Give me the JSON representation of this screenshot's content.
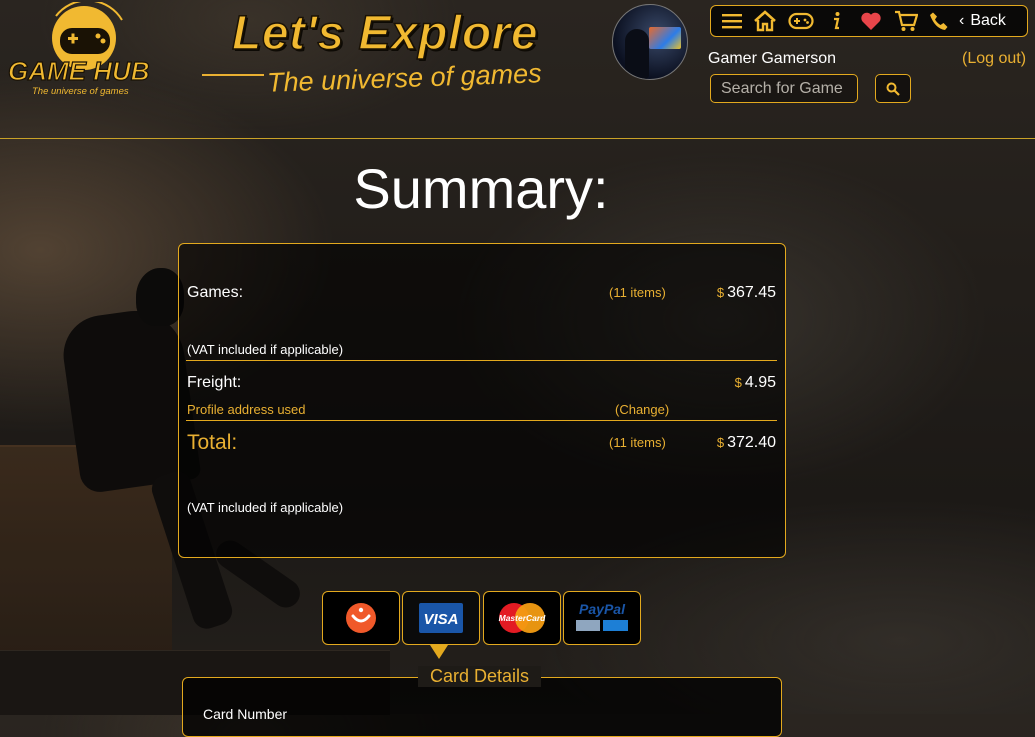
{
  "header": {
    "logo_text": "GAME HUB",
    "logo_tagline": "The universe of games",
    "slogan_main": "Let's Explore",
    "slogan_sub": "The universe of games"
  },
  "nav": {
    "items": [
      "menu-icon",
      "home-icon",
      "gamepad-icon",
      "info-icon",
      "heart-icon",
      "cart-icon",
      "phone-icon"
    ],
    "back_label": "Back"
  },
  "user": {
    "name": "Gamer Gamerson",
    "logout_label": "(Log out)"
  },
  "search": {
    "placeholder": "Search for Game"
  },
  "page": {
    "title": "Summary:"
  },
  "summary": {
    "currency_symbol": "$",
    "games": {
      "label": "Games:",
      "count": "(11 items)",
      "price": "367.45",
      "vat_note": "(VAT included if applicable)"
    },
    "freight": {
      "label": "Freight:",
      "price": "4.95",
      "address_note": "Profile address used",
      "change_label": "(Change)"
    },
    "total": {
      "label": "Total:",
      "count": "(11 items)",
      "price": "372.40",
      "vat_note": "(VAT included if applicable)"
    }
  },
  "payment": {
    "methods": [
      "Smile",
      "VISA",
      "MasterCard",
      "PayPal"
    ],
    "active": "VISA",
    "card_details_label": "Card Details",
    "card_number_label": "Card Number"
  },
  "colors": {
    "accent": "#e3a91e",
    "gold_text": "#e9b032",
    "background": "#221e1a"
  }
}
